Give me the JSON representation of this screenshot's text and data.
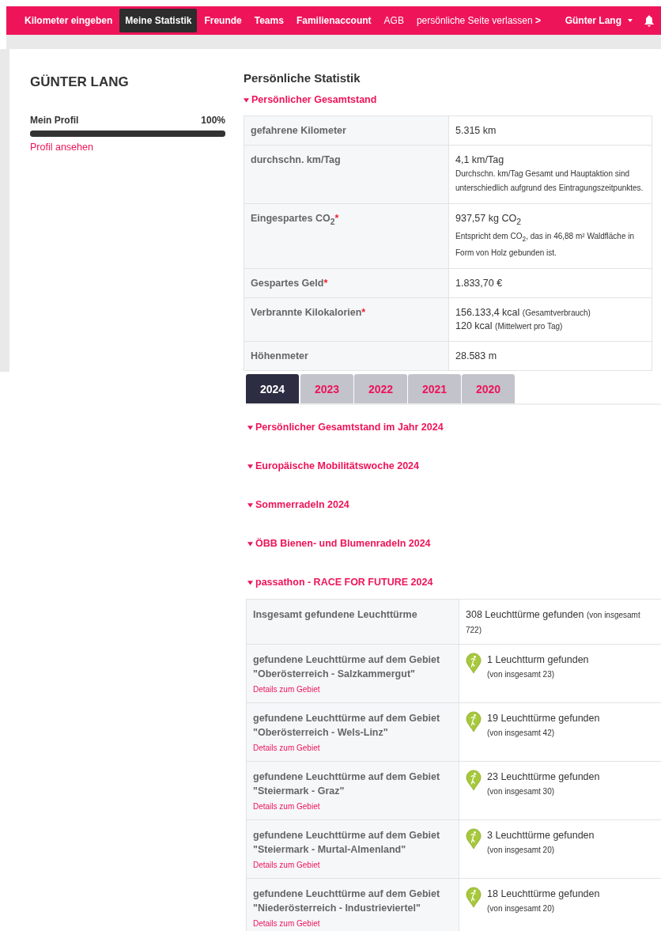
{
  "nav": {
    "items": [
      {
        "label": "Kilometer eingeben",
        "selected": false,
        "kind": "bold"
      },
      {
        "label": "Meine Statistik",
        "selected": true,
        "kind": "bold"
      },
      {
        "label": "Freunde",
        "selected": false,
        "kind": "bold"
      },
      {
        "label": "Teams",
        "selected": false,
        "kind": "bold"
      },
      {
        "label": "Familienaccount",
        "selected": false,
        "kind": "bold"
      },
      {
        "label": "AGB",
        "selected": false,
        "kind": "plain"
      },
      {
        "label": "persönliche Seite verlassen **>**",
        "selected": false,
        "kind": "plain"
      }
    ],
    "user": "Günter Lang"
  },
  "profile": {
    "name": "GÜNTER LANG",
    "progress_label": "Mein Profil",
    "percent": "100%",
    "level": 1,
    "link": "Profil ansehen"
  },
  "stats": {
    "title": "Persönliche Statistik",
    "section": {
      "label": "Persönlicher Gesamtstand",
      "expanded": true
    },
    "rows": [
      {
        "label": "gefahrene Kilometer",
        "lines": [
          {
            "text": "5.315 km"
          }
        ]
      },
      {
        "label": "durchschn. km/Tag",
        "lines": [
          {
            "text": "4,1 km/Tag"
          }
        ],
        "note": "Durchschn. km/Tag Gesamt und Hauptaktion sind unterschiedlich aufgrund des Eintragungszeitpunktes."
      },
      {
        "label": "Eingespartes CO$_{2}$",
        "mark": "*",
        "lines": [
          {
            "text": "937,57 kg CO$_{2}$"
          }
        ],
        "note": "Entspricht dem CO$_{2}$, das in 46,88 m² Waldfläche in Form von Holz gebunden ist."
      },
      {
        "label": "Gespartes Geld",
        "mark": "*",
        "lines": [
          {
            "text": "1.833,70 €"
          }
        ]
      },
      {
        "label": "Verbrannte Kilokalorien",
        "mark": "*",
        "lines": [
          {
            "text": "156.133,4 kcal",
            "small": "(Gesamtverbrauch)"
          },
          {
            "text": "120 kcal",
            "small": "(Mittelwert pro Tag)"
          }
        ]
      },
      {
        "label": "Höhenmeter",
        "lines": [
          {
            "text": "28.583 m"
          }
        ]
      }
    ]
  },
  "year_tabs": [
    {
      "label": "2024",
      "selected": true
    },
    {
      "label": "2023",
      "selected": false
    },
    {
      "label": "2022",
      "selected": false
    },
    {
      "label": "2021",
      "selected": false
    },
    {
      "label": "2020",
      "selected": false
    }
  ],
  "sections": [
    {
      "label": "Persönlicher Gesamtstand im Jahr 2024",
      "expanded": true
    },
    {
      "label": "Europäische Mobilitätswoche 2024",
      "expanded": true
    },
    {
      "label": "Sommerradeln 2024",
      "expanded": true
    },
    {
      "label": "ÖBB Bienen- und Blumenradeln 2024",
      "expanded": true
    },
    {
      "label": "passathon - RACE FOR FUTURE 2024",
      "expanded": true
    }
  ],
  "lighthouses": {
    "rows": [
      {
        "kind": "total",
        "label": "Insgesamt gefundene Leuchttürme",
        "value": "308 Leuchttürme gefunden",
        "note": "(von insgesamt 722)"
      },
      {
        "kind": "region",
        "label": "gefundene Leuchttürme auf dem Gebiet \"Oberösterreich - Salzkammergut\"",
        "link": "Details zum Gebiet",
        "value": "1 Leuchtturm gefunden",
        "note": "(von insgesamt 23)"
      },
      {
        "kind": "region",
        "label": "gefundene Leuchttürme auf dem Gebiet \"Oberösterreich - Wels-Linz\"",
        "link": "Details zum Gebiet",
        "value": "19 Leuchttürme gefunden",
        "note": "(von insgesamt 42)"
      },
      {
        "kind": "region",
        "label": "gefundene Leuchttürme auf dem Gebiet \"Steiermark - Graz\"",
        "link": "Details zum Gebiet",
        "value": "23 Leuchttürme gefunden",
        "note": "(von insgesamt 30)"
      },
      {
        "kind": "region",
        "label": "gefundene Leuchttürme auf dem Gebiet \"Steiermark - Murtal-Almenland\"",
        "link": "Details zum Gebiet",
        "value": "3 Leuchttürme gefunden",
        "note": "(von insgesamt 20)"
      },
      {
        "kind": "region",
        "label": "gefundene Leuchttürme auf dem Gebiet \"Niederösterreich - Industrieviertel\"",
        "link": "Details zum Gebiet",
        "value": "18 Leuchttürme gefunden",
        "note": "(von insgesamt 20)"
      }
    ]
  }
}
